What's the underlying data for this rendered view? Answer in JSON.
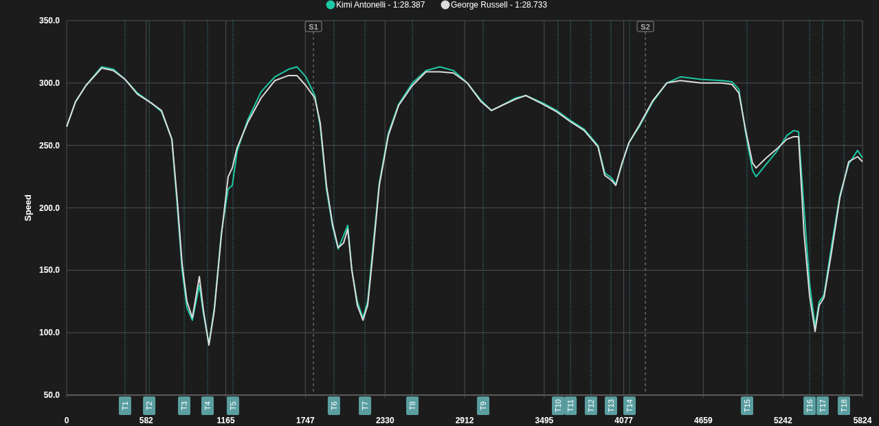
{
  "chart": {
    "chart_data": {
      "type": "line",
      "ylabel": "Speed",
      "x": [
        0,
        65,
        141,
        256,
        342,
        427,
        518,
        619,
        694,
        770,
        810,
        845,
        880,
        920,
        971,
        1001,
        1041,
        1081,
        1132,
        1182,
        1212,
        1247,
        1323,
        1423,
        1524,
        1624,
        1685,
        1750,
        1816,
        1856,
        1901,
        1946,
        1987,
        2027,
        2057,
        2087,
        2127,
        2168,
        2203,
        2238,
        2288,
        2354,
        2429,
        2530,
        2630,
        2731,
        2831,
        2932,
        3033,
        3108,
        3184,
        3285,
        3360,
        3485,
        3586,
        3687,
        3787,
        3888,
        3938,
        3988,
        4019,
        4064,
        4114,
        4190,
        4290,
        4391,
        4491,
        4642,
        4793,
        4868,
        4919,
        4969,
        5019,
        5045,
        5120,
        5195,
        5271,
        5321,
        5356,
        5396,
        5436,
        5477,
        5507,
        5542,
        5598,
        5658,
        5723,
        5788,
        5824
      ],
      "series": [
        {
          "name": "Kimi Antonelli - 1:28.387",
          "color": "#1ec8a5",
          "values": [
            265,
            285,
            298,
            313,
            311,
            303,
            292,
            284,
            277,
            255,
            200,
            150,
            120,
            110,
            138,
            115,
            91,
            120,
            180,
            215,
            218,
            245,
            270,
            293,
            305,
            311,
            313,
            305,
            290,
            265,
            215,
            185,
            167,
            178,
            186,
            150,
            125,
            112,
            125,
            165,
            220,
            260,
            283,
            300,
            310,
            313,
            310,
            300,
            286,
            278,
            282,
            288,
            290,
            284,
            278,
            270,
            263,
            250,
            228,
            224,
            219,
            235,
            252,
            265,
            285,
            300,
            305,
            303,
            302,
            301,
            295,
            260,
            230,
            225,
            235,
            245,
            258,
            262,
            261,
            200,
            140,
            105,
            125,
            130,
            170,
            210,
            235,
            246,
            240
          ]
        },
        {
          "name": "George Russell - 1:28.733",
          "color": "#dcdcdc",
          "values": [
            265,
            285,
            298,
            312,
            310,
            303,
            291,
            284,
            278,
            255,
            205,
            155,
            125,
            112,
            145,
            118,
            90,
            118,
            178,
            225,
            232,
            248,
            268,
            288,
            302,
            306,
            306,
            298,
            288,
            268,
            218,
            187,
            168,
            172,
            183,
            150,
            122,
            110,
            122,
            160,
            218,
            258,
            282,
            298,
            309,
            309,
            308,
            300,
            285,
            278,
            282,
            287,
            290,
            283,
            277,
            269,
            262,
            249,
            226,
            222,
            218,
            236,
            252,
            266,
            286,
            300,
            302,
            300,
            300,
            299,
            292,
            262,
            236,
            232,
            240,
            247,
            255,
            257,
            257,
            180,
            130,
            101,
            122,
            128,
            165,
            208,
            237,
            241,
            237
          ]
        }
      ],
      "xlim": [
        0,
        5824
      ],
      "ylim": [
        50,
        350
      ],
      "xticks": [
        0,
        582,
        1165,
        1747,
        2330,
        2912,
        3495,
        4077,
        4659,
        5242,
        5824
      ],
      "yticks": [
        {
          "value": 50,
          "label": "50.0"
        },
        {
          "value": 100,
          "label": "100.0"
        },
        {
          "value": 150,
          "label": "150.0"
        },
        {
          "value": 200,
          "label": "200.0"
        },
        {
          "value": 250,
          "label": "250.0"
        },
        {
          "value": 300,
          "label": "300.0"
        },
        {
          "value": 350,
          "label": "350.0"
        }
      ],
      "grid": true,
      "legend": true,
      "ref_lines": [
        {
          "axis": "x",
          "label": "S1",
          "value": 1806
        },
        {
          "axis": "x",
          "label": "S2",
          "value": 4235
        },
        {
          "axis": "x",
          "label": "T1",
          "value": 427
        },
        {
          "axis": "x",
          "label": "T2",
          "value": 604
        },
        {
          "axis": "x",
          "label": "T3",
          "value": 860
        },
        {
          "axis": "x",
          "label": "T4",
          "value": 1031
        },
        {
          "axis": "x",
          "label": "T5",
          "value": 1217
        },
        {
          "axis": "x",
          "label": "T6",
          "value": 1956
        },
        {
          "axis": "x",
          "label": "T7",
          "value": 2183
        },
        {
          "axis": "x",
          "label": "T8",
          "value": 2530
        },
        {
          "axis": "x",
          "label": "T9",
          "value": 3048
        },
        {
          "axis": "x",
          "label": "T10",
          "value": 3596
        },
        {
          "axis": "x",
          "label": "T11",
          "value": 3687
        },
        {
          "axis": "x",
          "label": "T12",
          "value": 3837
        },
        {
          "axis": "x",
          "label": "T13",
          "value": 3983
        },
        {
          "axis": "x",
          "label": "T14",
          "value": 4119
        },
        {
          "axis": "x",
          "label": "T15",
          "value": 4979
        },
        {
          "axis": "x",
          "label": "T16",
          "value": 5437
        },
        {
          "axis": "x",
          "label": "T17",
          "value": 5532
        },
        {
          "axis": "x",
          "label": "T18",
          "value": 5688
        }
      ]
    }
  }
}
